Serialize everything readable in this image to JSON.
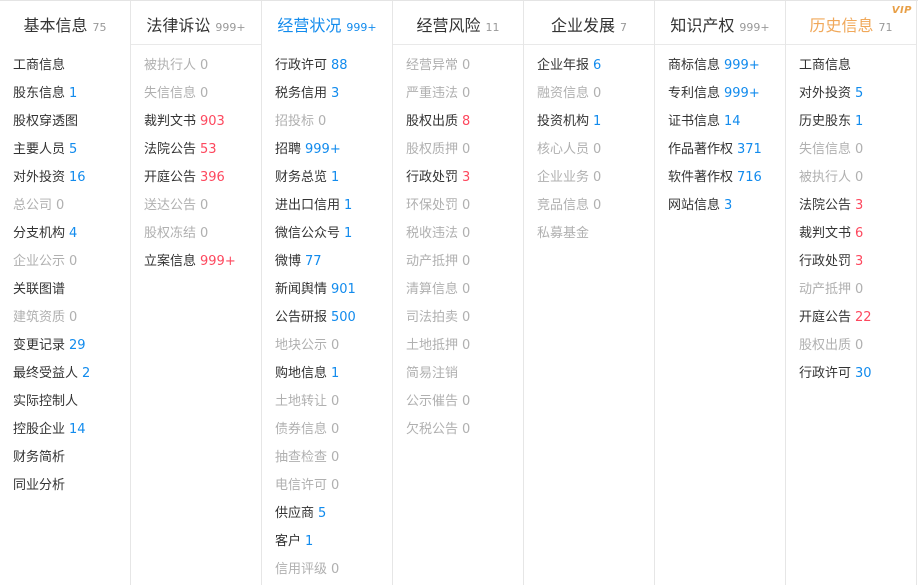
{
  "vip_badge": "VIP",
  "columns": [
    {
      "title": "基本信息",
      "count": "75",
      "state": "first",
      "items": [
        {
          "label": "工商信息",
          "count": "",
          "tone": ""
        },
        {
          "label": "股东信息",
          "count": "1",
          "tone": "blue"
        },
        {
          "label": "股权穿透图",
          "count": "",
          "tone": ""
        },
        {
          "label": "主要人员",
          "count": "5",
          "tone": "blue"
        },
        {
          "label": "对外投资",
          "count": "16",
          "tone": "blue"
        },
        {
          "label": "总公司",
          "count": "0",
          "tone": "gray"
        },
        {
          "label": "分支机构",
          "count": "4",
          "tone": "blue"
        },
        {
          "label": "企业公示",
          "count": "0",
          "tone": "gray"
        },
        {
          "label": "关联图谱",
          "count": "",
          "tone": ""
        },
        {
          "label": "建筑资质",
          "count": "0",
          "tone": "gray"
        },
        {
          "label": "变更记录",
          "count": "29",
          "tone": "blue"
        },
        {
          "label": "最终受益人",
          "count": "2",
          "tone": "blue"
        },
        {
          "label": "实际控制人",
          "count": "",
          "tone": ""
        },
        {
          "label": "控股企业",
          "count": "14",
          "tone": "blue"
        },
        {
          "label": "财务简析",
          "count": "",
          "tone": ""
        },
        {
          "label": "同业分析",
          "count": "",
          "tone": ""
        }
      ]
    },
    {
      "title": "法律诉讼",
      "count": "999+",
      "state": "",
      "items": [
        {
          "label": "被执行人",
          "count": "0",
          "tone": "gray"
        },
        {
          "label": "失信信息",
          "count": "0",
          "tone": "gray"
        },
        {
          "label": "裁判文书",
          "count": "903",
          "tone": "pink"
        },
        {
          "label": "法院公告",
          "count": "53",
          "tone": "pink"
        },
        {
          "label": "开庭公告",
          "count": "396",
          "tone": "pink"
        },
        {
          "label": "送达公告",
          "count": "0",
          "tone": "gray"
        },
        {
          "label": "股权冻结",
          "count": "0",
          "tone": "gray"
        },
        {
          "label": "立案信息",
          "count": "999+",
          "tone": "pink"
        }
      ]
    },
    {
      "title": "经营状况",
      "count": "999+",
      "state": "active",
      "items": [
        {
          "label": "行政许可",
          "count": "88",
          "tone": "blue"
        },
        {
          "label": "税务信用",
          "count": "3",
          "tone": "blue"
        },
        {
          "label": "招投标",
          "count": "0",
          "tone": "gray"
        },
        {
          "label": "招聘",
          "count": "999+",
          "tone": "blue"
        },
        {
          "label": "财务总览",
          "count": "1",
          "tone": "blue"
        },
        {
          "label": "进出口信用",
          "count": "1",
          "tone": "blue"
        },
        {
          "label": "微信公众号",
          "count": "1",
          "tone": "blue"
        },
        {
          "label": "微博",
          "count": "77",
          "tone": "blue"
        },
        {
          "label": "新闻舆情",
          "count": "901",
          "tone": "blue"
        },
        {
          "label": "公告研报",
          "count": "500",
          "tone": "blue"
        },
        {
          "label": "地块公示",
          "count": "0",
          "tone": "gray"
        },
        {
          "label": "购地信息",
          "count": "1",
          "tone": "blue"
        },
        {
          "label": "土地转让",
          "count": "0",
          "tone": "gray"
        },
        {
          "label": "债券信息",
          "count": "0",
          "tone": "gray"
        },
        {
          "label": "抽查检查",
          "count": "0",
          "tone": "gray"
        },
        {
          "label": "电信许可",
          "count": "0",
          "tone": "gray"
        },
        {
          "label": "供应商",
          "count": "5",
          "tone": "blue"
        },
        {
          "label": "客户",
          "count": "1",
          "tone": "blue"
        },
        {
          "label": "信用评级",
          "count": "0",
          "tone": "gray"
        }
      ]
    },
    {
      "title": "经营风险",
      "count": "11",
      "state": "",
      "items": [
        {
          "label": "经营异常",
          "count": "0",
          "tone": "gray"
        },
        {
          "label": "严重违法",
          "count": "0",
          "tone": "gray"
        },
        {
          "label": "股权出质",
          "count": "8",
          "tone": "pink"
        },
        {
          "label": "股权质押",
          "count": "0",
          "tone": "gray"
        },
        {
          "label": "行政处罚",
          "count": "3",
          "tone": "pink"
        },
        {
          "label": "环保处罚",
          "count": "0",
          "tone": "gray"
        },
        {
          "label": "税收违法",
          "count": "0",
          "tone": "gray"
        },
        {
          "label": "动产抵押",
          "count": "0",
          "tone": "gray"
        },
        {
          "label": "清算信息",
          "count": "0",
          "tone": "gray"
        },
        {
          "label": "司法拍卖",
          "count": "0",
          "tone": "gray"
        },
        {
          "label": "土地抵押",
          "count": "0",
          "tone": "gray"
        },
        {
          "label": "简易注销",
          "count": "",
          "tone": "gray"
        },
        {
          "label": "公示催告",
          "count": "0",
          "tone": "gray"
        },
        {
          "label": "欠税公告",
          "count": "0",
          "tone": "gray"
        }
      ]
    },
    {
      "title": "企业发展",
      "count": "7",
      "state": "",
      "items": [
        {
          "label": "企业年报",
          "count": "6",
          "tone": "blue"
        },
        {
          "label": "融资信息",
          "count": "0",
          "tone": "gray"
        },
        {
          "label": "投资机构",
          "count": "1",
          "tone": "blue"
        },
        {
          "label": "核心人员",
          "count": "0",
          "tone": "gray"
        },
        {
          "label": "企业业务",
          "count": "0",
          "tone": "gray"
        },
        {
          "label": "竞品信息",
          "count": "0",
          "tone": "gray"
        },
        {
          "label": "私募基金",
          "count": "",
          "tone": "gray"
        }
      ]
    },
    {
      "title": "知识产权",
      "count": "999+",
      "state": "",
      "items": [
        {
          "label": "商标信息",
          "count": "999+",
          "tone": "blue"
        },
        {
          "label": "专利信息",
          "count": "999+",
          "tone": "blue"
        },
        {
          "label": "证书信息",
          "count": "14",
          "tone": "blue"
        },
        {
          "label": "作品著作权",
          "count": "371",
          "tone": "blue"
        },
        {
          "label": "软件著作权",
          "count": "716",
          "tone": "blue"
        },
        {
          "label": "网站信息",
          "count": "3",
          "tone": "blue"
        }
      ]
    },
    {
      "title": "历史信息",
      "count": "71",
      "state": "history",
      "items": [
        {
          "label": "工商信息",
          "count": "",
          "tone": ""
        },
        {
          "label": "对外投资",
          "count": "5",
          "tone": "blue"
        },
        {
          "label": "历史股东",
          "count": "1",
          "tone": "blue"
        },
        {
          "label": "失信信息",
          "count": "0",
          "tone": "gray"
        },
        {
          "label": "被执行人",
          "count": "0",
          "tone": "gray"
        },
        {
          "label": "法院公告",
          "count": "3",
          "tone": "pink"
        },
        {
          "label": "裁判文书",
          "count": "6",
          "tone": "pink"
        },
        {
          "label": "行政处罚",
          "count": "3",
          "tone": "pink"
        },
        {
          "label": "动产抵押",
          "count": "0",
          "tone": "gray"
        },
        {
          "label": "开庭公告",
          "count": "22",
          "tone": "pink"
        },
        {
          "label": "股权出质",
          "count": "0",
          "tone": "gray"
        },
        {
          "label": "行政许可",
          "count": "30",
          "tone": "blue"
        }
      ]
    }
  ]
}
